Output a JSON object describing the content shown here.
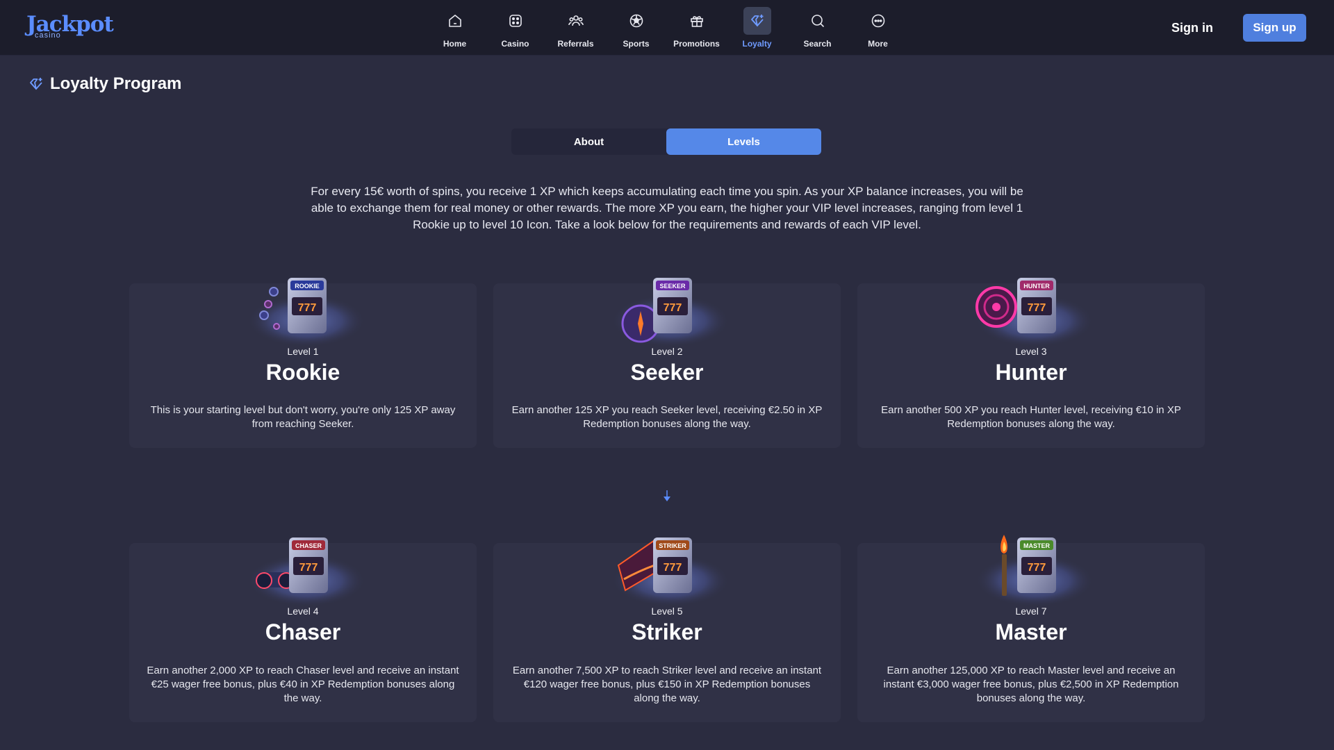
{
  "header": {
    "logo": {
      "main": "Jackpot",
      "sub": "casino"
    },
    "nav": [
      {
        "label": "Home",
        "icon": "home-icon"
      },
      {
        "label": "Casino",
        "icon": "dice-icon"
      },
      {
        "label": "Referrals",
        "icon": "users-icon"
      },
      {
        "label": "Sports",
        "icon": "soccer-ball-icon"
      },
      {
        "label": "Promotions",
        "icon": "gift-icon"
      },
      {
        "label": "Loyalty",
        "icon": "diamond-icon"
      },
      {
        "label": "Search",
        "icon": "search-icon"
      },
      {
        "label": "More",
        "icon": "more-icon"
      }
    ],
    "active_nav": "Loyalty",
    "signin_label": "Sign in",
    "signup_label": "Sign up"
  },
  "page": {
    "title": "Loyalty Program",
    "title_icon": "diamond-icon",
    "tabs": [
      {
        "label": "About"
      },
      {
        "label": "Levels"
      }
    ],
    "active_tab": "Levels",
    "intro": "For every 15€ worth of spins, you receive 1 XP which keeps accumulating each time you spin. As your XP balance increases, you will be able to exchange them for real money or other rewards. The more XP you earn, the higher your VIP level increases, ranging from level 1 Rookie up to level 10 Icon. Take a look below for the requirements and rewards of each VIP level."
  },
  "levels": [
    {
      "level_label": "Level 1",
      "name": "Rookie",
      "sign": "ROOKIE",
      "prop": "chips",
      "description": "This is your starting level but don't worry, you're only 125 XP away from reaching Seeker."
    },
    {
      "level_label": "Level 2",
      "name": "Seeker",
      "sign": "SEEKER",
      "prop": "compass",
      "description": "Earn another 125 XP you reach Seeker level, receiving €2.50 in XP Redemption bonuses along the way."
    },
    {
      "level_label": "Level 3",
      "name": "Hunter",
      "sign": "HUNTER",
      "prop": "target",
      "description": "Earn another 500 XP you reach Hunter level, receiving €10 in XP Redemption bonuses along the way."
    },
    {
      "level_label": "Level 4",
      "name": "Chaser",
      "sign": "CHASER",
      "prop": "binoculars",
      "description": "Earn another 2,000 XP to reach Chaser level and receive an instant €25 wager free bonus, plus €40 in XP Redemption bonuses along the way."
    },
    {
      "level_label": "Level 5",
      "name": "Striker",
      "sign": "STRIKER",
      "prop": "flag",
      "description": "Earn another 7,500 XP to reach Striker level and receive an instant €120 wager free bonus, plus €150 in XP Redemption bonuses along the way."
    },
    {
      "level_label": "Level 7",
      "name": "Master",
      "sign": "MASTER",
      "prop": "torch",
      "description": "Earn another 125,000 XP to reach Master level and receive an instant €3,000 wager free bonus, plus €2,500 in XP Redemption bonuses along the way."
    }
  ],
  "colors": {
    "accent": "#5588e8",
    "header_bg": "#1c1d2b",
    "page_bg": "#2b2c40",
    "card_bg": "#303146"
  }
}
